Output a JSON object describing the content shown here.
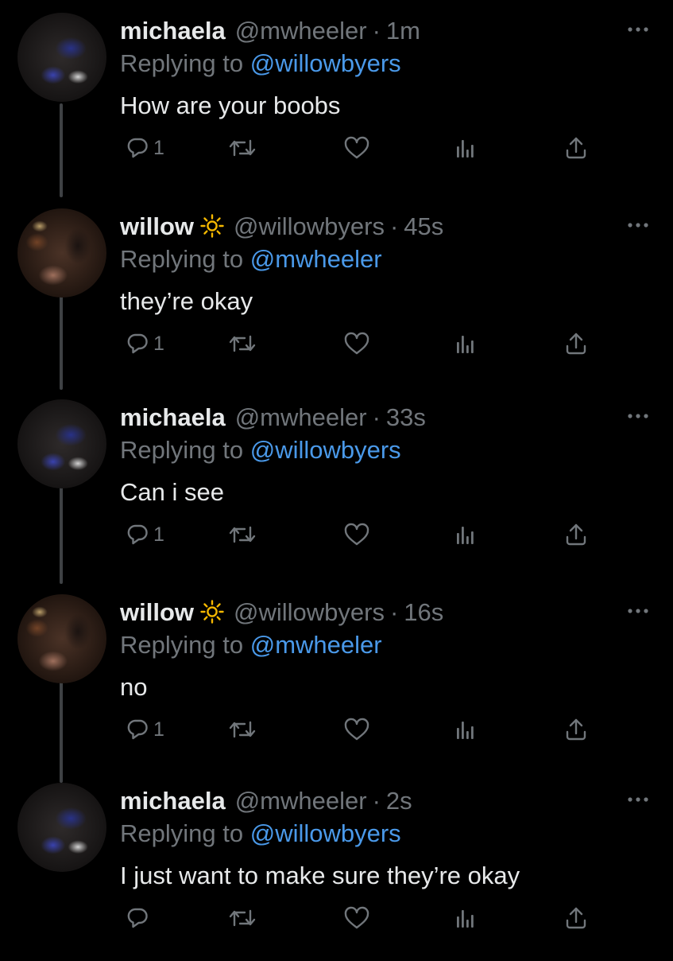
{
  "tweets": [
    {
      "author": "michaela",
      "handle": "@mwheeler",
      "separator": "·",
      "time": "1m",
      "replying_label": "Replying to",
      "replying_to": "@willowbyers",
      "text": "How are your boobs",
      "reply_count": "1",
      "avatar": "michaela"
    },
    {
      "author": "willow",
      "handle": "@willowbyers",
      "separator": "·",
      "time": "45s",
      "replying_label": "Replying to",
      "replying_to": "@mwheeler",
      "text": "they’re okay",
      "reply_count": "1",
      "avatar": "willow"
    },
    {
      "author": "michaela",
      "handle": "@mwheeler",
      "separator": "·",
      "time": "33s",
      "replying_label": "Replying to",
      "replying_to": "@willowbyers",
      "text": "Can i see",
      "reply_count": "1",
      "avatar": "michaela"
    },
    {
      "author": "willow",
      "handle": "@willowbyers",
      "separator": "·",
      "time": "16s",
      "replying_label": "Replying to",
      "replying_to": "@mwheeler",
      "text": "no",
      "reply_count": "1",
      "avatar": "willow"
    },
    {
      "author": "michaela",
      "handle": "@mwheeler",
      "separator": "·",
      "time": "2s",
      "replying_label": "Replying to",
      "replying_to": "@willowbyers",
      "text": "I just want to make sure they’re okay",
      "reply_count": "",
      "avatar": "michaela"
    }
  ],
  "icons": {
    "author_badge": "sun-icon",
    "more": "more-icon",
    "reply": "reply-icon",
    "retweet": "retweet-icon",
    "like": "heart-icon",
    "views": "views-icon",
    "share": "share-icon"
  },
  "colors": {
    "background": "#000000",
    "text": "#e7e9ea",
    "secondary": "#71767b",
    "mention": "#4a99e9",
    "thread_line": "#3e4144",
    "sun_badge": "#f5b800"
  }
}
